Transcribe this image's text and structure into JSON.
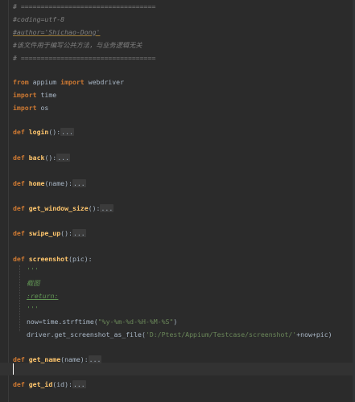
{
  "code": {
    "l1": "# ==================================",
    "l2": "#coding=utf-8",
    "l3": "#author='Shichao-Dong'",
    "l4": "#该文件用于编写公共方法，与业务逻辑无关",
    "l5": "# ==================================",
    "imp1_kw": "from",
    "imp1_mod": " appium ",
    "imp1_kw2": "import",
    "imp1_name": " webdriver",
    "imp2_kw": "import",
    "imp2_name": " time",
    "imp3_kw": "import",
    "imp3_name": " os",
    "def_kw": "def ",
    "login": "login",
    "login_args": "():",
    "fold": "...",
    "back": "back",
    "back_args": "():",
    "home": "home",
    "home_args": "(name):",
    "gws": "get_window_size",
    "gws_args": "():",
    "swipe": "swipe_up",
    "swipe_args": "():",
    "ss": "screenshot",
    "ss_args": "(pic):",
    "doc1": "'''",
    "doc2": "截图",
    "doc3": ":return:",
    "doc4": "'''",
    "now_a": "now=time.strftime(",
    "now_s": "\"%y-%m-%d-%H-%M-%S\"",
    "now_b": ")",
    "drv_a": "driver.get_screenshot_as_file(",
    "drv_s": "'D:/Ptest/Appium/Testcase/screenshot/'",
    "drv_b": "+now+pic)",
    "gn": "get_name",
    "gn_args": "(name):",
    "gi": "get_id",
    "gi_args": "(id):"
  }
}
